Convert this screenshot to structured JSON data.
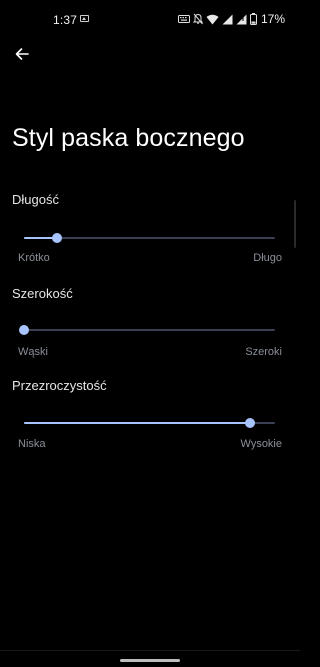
{
  "status_bar": {
    "time": "1:37",
    "battery_percent": "17%",
    "icons": [
      "image-icon",
      "keyboard-icon",
      "mute-icon",
      "wifi-icon",
      "signal-icon",
      "battery-icon"
    ]
  },
  "header": {
    "back_icon": "arrow-left-icon",
    "title": "Styl paska bocznego"
  },
  "settings": [
    {
      "label": "Długość",
      "min_label": "Krótko",
      "max_label": "Długo",
      "value": 0.13
    },
    {
      "label": "Szerokość",
      "min_label": "Wąski",
      "max_label": "Szeroki",
      "value": 0.0
    },
    {
      "label": "Przezroczystość",
      "min_label": "Niska",
      "max_label": "Wysokie",
      "value": 0.9
    }
  ],
  "colors": {
    "background": "#000000",
    "accent": "#a8c4ff",
    "track": "#3a4152",
    "secondary_text": "#8a8f98"
  }
}
